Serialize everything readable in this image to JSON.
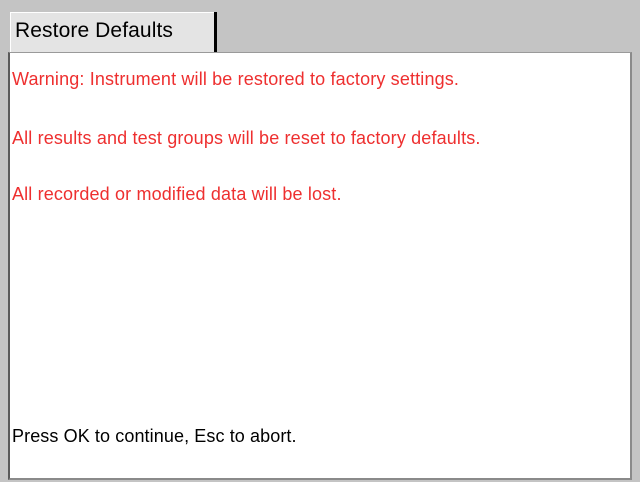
{
  "tab": {
    "title": "Restore Defaults"
  },
  "messages": {
    "warning": "Warning: Instrument will be restored to factory settings.",
    "reset": "All results and test groups will be reset to factory defaults.",
    "lost": "All recorded or modified data will be lost."
  },
  "prompt": {
    "text": "Press OK to continue, Esc to abort."
  },
  "colors": {
    "warning_text": "#ee2f2f",
    "normal_text": "#000000",
    "background": "#c4c4c4",
    "panel": "#ffffff"
  }
}
